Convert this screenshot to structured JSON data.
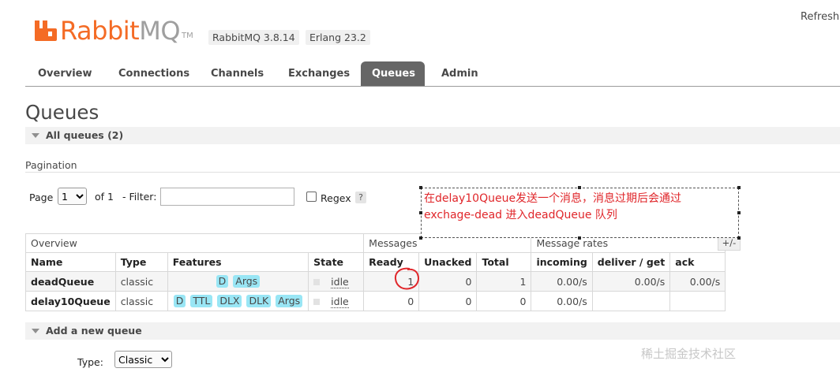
{
  "header": {
    "logo_text_1": "Rabbit",
    "logo_text_2": "MQ",
    "logo_tm": "TM",
    "version_badge": "RabbitMQ 3.8.14",
    "erlang_badge": "Erlang 23.2",
    "refresh_label": "Refresh"
  },
  "tabs": [
    {
      "label": "Overview"
    },
    {
      "label": "Connections"
    },
    {
      "label": "Channels"
    },
    {
      "label": "Exchanges"
    },
    {
      "label": "Queues"
    },
    {
      "label": "Admin"
    }
  ],
  "active_tab": "Queues",
  "page_title": "Queues",
  "all_queues_label": "All queues (2)",
  "pagination": {
    "label": "Pagination",
    "page_label": "Page",
    "page_value": "1",
    "of_label": "of 1",
    "filter_label": "- Filter:",
    "filter_value": "",
    "regex_label": "Regex",
    "regex_help": "?"
  },
  "table": {
    "groups": {
      "overview": "Overview",
      "messages": "Messages",
      "rates": "Message rates"
    },
    "plus_minus": "+/-",
    "columns": [
      "Name",
      "Type",
      "Features",
      "State",
      "Ready",
      "Unacked",
      "Total",
      "incoming",
      "deliver / get",
      "ack"
    ],
    "rows": [
      {
        "name": "deadQueue",
        "type": "classic",
        "features": [
          "D",
          "Args"
        ],
        "state": "idle",
        "ready": "1",
        "unacked": "0",
        "total": "1",
        "incoming": "0.00/s",
        "deliver_get": "0.00/s",
        "ack": "0.00/s"
      },
      {
        "name": "delay10Queue",
        "type": "classic",
        "features": [
          "D",
          "TTL",
          "DLX",
          "DLK",
          "Args"
        ],
        "state": "idle",
        "ready": "0",
        "unacked": "0",
        "total": "0",
        "incoming": "0.00/s",
        "deliver_get": "",
        "ack": ""
      }
    ]
  },
  "annotation": {
    "line1": "在delay10Queue发送一个消息，消息过期后会通过",
    "line2": "exchage-dead 进入deadQueue 队列",
    "color": "#e0262a"
  },
  "add_queue": {
    "label": "Add a new queue",
    "type_label": "Type:",
    "type_value": "Classic"
  },
  "watermark": "稀土掘金技术社区",
  "colors": {
    "brand_orange": "#f46b25",
    "tab_active_bg": "#666666",
    "feature_tag_bg": "#99e6f5",
    "annotation_red": "#e0262a"
  }
}
